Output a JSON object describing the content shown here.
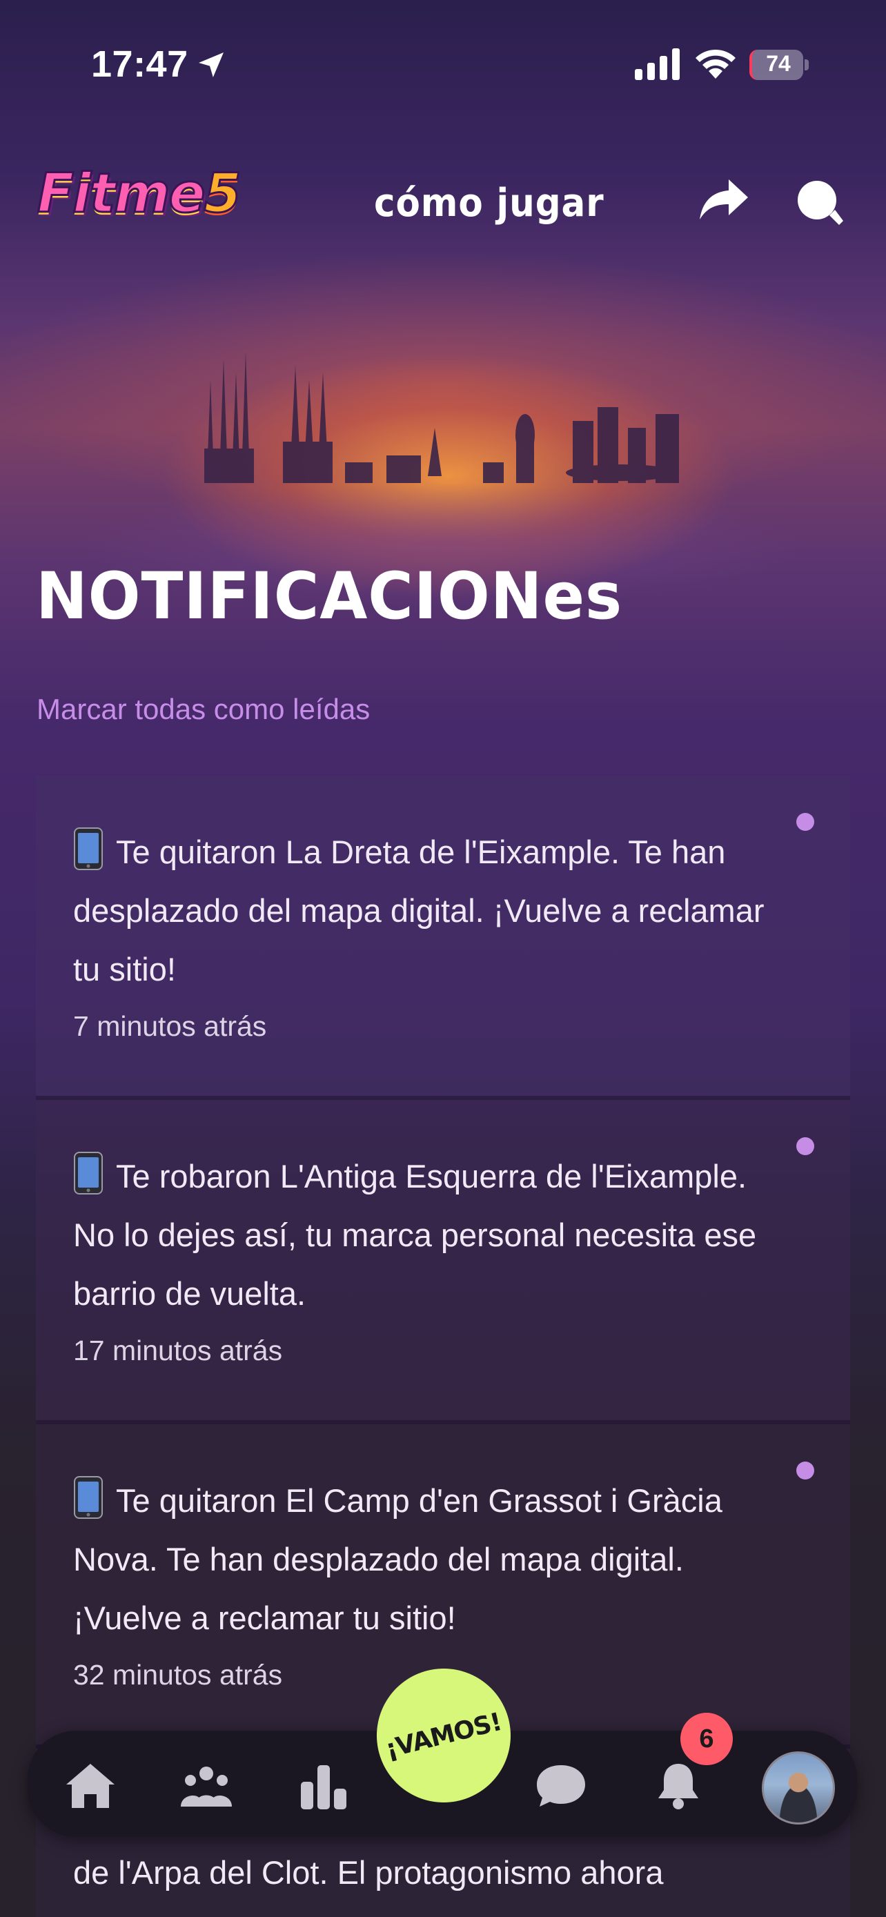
{
  "status_bar": {
    "time": "17:47",
    "battery": "74"
  },
  "header": {
    "logo_text": "Fitme",
    "logo_number": "5",
    "how_to_play": "cómo jugar"
  },
  "page": {
    "title": "NOTIFICACIONes",
    "mark_all_read": "Marcar todas como leídas"
  },
  "notifications": [
    {
      "text": "Te quitaron La Dreta de l'Eixample. Te han desplazado del mapa digital. ¡Vuelve a reclamar tu sitio!",
      "time": "7 minutos atrás",
      "unread": true
    },
    {
      "text": "Te robaron L'Antiga Esquerra de l'Eixample. No lo dejes así, tu marca personal necesita ese barrio de vuelta.",
      "time": "17 minutos atrás",
      "unread": true
    },
    {
      "text": "Te quitaron El Camp d'en Grassot i Gràcia Nova. Te han desplazado del mapa digital. ¡Vuelve a reclamar tu sitio!",
      "time": "32 minutos atrás",
      "unread": true
    }
  ],
  "partial_notification": "de l'Arpa del Clot. El protagonismo ahora",
  "bottom_nav": {
    "go_label": "¡VAMOS!",
    "notification_count": "6"
  },
  "colors": {
    "accent_purple": "#c58de6",
    "go_green": "#d6f77a",
    "badge_red": "#ff5a68"
  }
}
